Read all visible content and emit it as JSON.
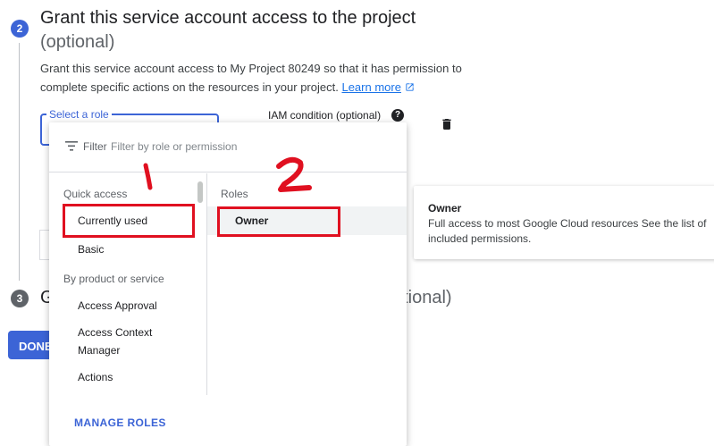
{
  "step2": {
    "number": "2",
    "title": "Grant this service account access to the project",
    "optional": "(optional)",
    "description": "Grant this service account access to My Project 80249 so that it has permission to complete specific actions on the resources in your project.",
    "learn_more": "Learn more"
  },
  "role_select": {
    "label": "Select a role"
  },
  "iam_condition": {
    "label": "IAM condition (optional)"
  },
  "step3": {
    "number": "3",
    "title_visible": "G",
    "optional_visible": "otional)"
  },
  "done_button": {
    "label": "DONE"
  },
  "dropdown": {
    "filter_label": "Filter",
    "filter_placeholder": "Filter by role or permission",
    "left_sections": [
      {
        "header": "Quick access",
        "items": [
          "Currently used",
          "Basic"
        ]
      },
      {
        "header": "By product or service",
        "items": [
          "Access Approval",
          "Access Context Manager",
          "Actions"
        ]
      }
    ],
    "roles_header": "Roles",
    "roles": [
      "Owner"
    ],
    "manage_roles": "MANAGE ROLES"
  },
  "info_card": {
    "title": "Owner",
    "description": "Full access to most Google Cloud resources See the list of included permissions."
  },
  "annotations": {
    "marker_1": "1",
    "marker_2": "2",
    "color": "#e01020"
  },
  "colors": {
    "accent": "#3c64d6",
    "link": "#1a73e8"
  },
  "icons": [
    "help-icon",
    "delete-icon",
    "filter-icon",
    "external-link-icon"
  ]
}
